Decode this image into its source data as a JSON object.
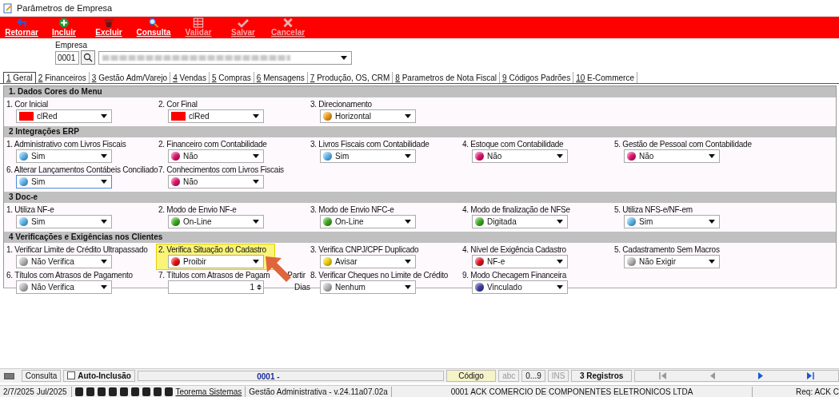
{
  "window": {
    "title": "Parâmetros de Empresa"
  },
  "toolbar": [
    {
      "label": "Retornar",
      "disabled": false
    },
    {
      "label": "Incluir",
      "disabled": false
    },
    {
      "label": "Excluir",
      "disabled": false
    },
    {
      "label": "Consulta",
      "disabled": false
    },
    {
      "label": "Validar",
      "disabled": true
    },
    {
      "label": "Salvar",
      "disabled": true
    },
    {
      "label": "Cancelar",
      "disabled": true
    }
  ],
  "empresa": {
    "label": "Empresa",
    "code": "0001"
  },
  "tabs": [
    {
      "number": "1",
      "label": "Geral",
      "selected": true
    },
    {
      "number": "2",
      "label": "Financeiros",
      "selected": false
    },
    {
      "number": "3",
      "label": "Gestão Adm/Varejo",
      "selected": false
    },
    {
      "number": "4",
      "label": "Vendas",
      "selected": false
    },
    {
      "number": "5",
      "label": "Compras",
      "selected": false
    },
    {
      "number": "6",
      "label": "Mensagens",
      "selected": false
    },
    {
      "number": "7",
      "label": "Produção, OS, CRM",
      "selected": false
    },
    {
      "number": "8",
      "label": "Parametros de Nota Fiscal",
      "selected": false
    },
    {
      "number": "9",
      "label": "Códigos Padrões",
      "selected": false
    },
    {
      "number": "10",
      "label": "E-Commerce",
      "selected": false
    }
  ],
  "sections": [
    {
      "title": "1.  Dados Cores do Menu",
      "fields": [
        {
          "label": "1. Cor Inicial",
          "kind": "color",
          "value": "clRed",
          "color": "#ff0000"
        },
        {
          "label": "2. Cor Final",
          "kind": "color",
          "value": "clRed",
          "color": "#ff0000"
        },
        {
          "label": "3. Direcionamento",
          "kind": "select",
          "value": "Horizontal",
          "color": "#f39a12"
        }
      ]
    },
    {
      "title": "2 Integrações ERP",
      "fields": [
        {
          "label": "1. Administrativo com Livros Fiscais",
          "kind": "select",
          "value": "Sim",
          "color": "#5ab4ee"
        },
        {
          "label": "2. Financeiro com Contabilidade",
          "kind": "select",
          "value": "Não",
          "color": "#e0106a"
        },
        {
          "label": "3. Livros Fiscais com Contabilidade",
          "kind": "select",
          "value": "Sim",
          "color": "#5ab4ee"
        },
        {
          "label": "4. Estoque com Contabilidade",
          "kind": "select",
          "value": "Não",
          "color": "#e0106a"
        },
        {
          "label": "5. Gestão de Pessoal com Contabilidade",
          "kind": "select",
          "value": "Não",
          "color": "#e0106a"
        },
        {
          "label": "6. Alterar Lançamentos Contábeis Conciliado",
          "kind": "select",
          "value": "Sim",
          "color": "#5ab4ee",
          "focused": true
        },
        {
          "label": "7. Conhecimentos com Livros Fiscais",
          "kind": "select",
          "value": "Não",
          "color": "#e0106a"
        }
      ]
    },
    {
      "title": "3  Doc-e",
      "fields": [
        {
          "label": "1. Utiliza NF-e",
          "kind": "select",
          "value": "Sim",
          "color": "#5ab4ee"
        },
        {
          "label": "2. Modo de Envio NF-e",
          "kind": "select",
          "value": "On-Line",
          "color": "#3aaa1e"
        },
        {
          "label": "3. Modo de Envio NFC-e",
          "kind": "select",
          "value": "On-Line",
          "color": "#3aaa1e"
        },
        {
          "label": "4. Modo de finalização de NFSe",
          "kind": "select",
          "value": "Digitada",
          "color": "#3aaa1e"
        },
        {
          "label": "5. Utiliza NFS-e/NF-em",
          "kind": "select",
          "value": "Sim",
          "color": "#5ab4ee"
        }
      ]
    },
    {
      "title": "4 Verificações e Exigências nos Clientes",
      "fields": [
        {
          "label": "1. Verificar Limite de Crédito Ultrapassado",
          "kind": "select",
          "value": "Não Verifica",
          "color": "#b4b4b4"
        },
        {
          "label": "2. Verifica Situação do Cadastro",
          "kind": "select",
          "value": "Proibir",
          "color": "#e81010",
          "highlighted": true
        },
        {
          "label": "3. Verifica CNPJ/CPF Duplicado",
          "kind": "select",
          "value": "Avisar",
          "color": "#f0d000"
        },
        {
          "label": "4. Nível de Exigência Cadastro",
          "kind": "select",
          "value": "NF-e",
          "color": "#e01020"
        },
        {
          "label": "5. Cadastramento Sem Macros",
          "kind": "select",
          "value": "Não Exigir",
          "color": "#b4b4b4"
        },
        {
          "label": "6. Títulos com Atrasos de Pagamento",
          "kind": "select",
          "value": "Não Verifica",
          "color": "#b4b4b4"
        },
        {
          "label": "7. Títulos com Atrasos de Pagam",
          "label_end": "Partir",
          "kind": "spin",
          "value": "1",
          "suffix": "Dias"
        },
        {
          "label": "8. Verificar Cheques no Limite de Crédito",
          "kind": "select",
          "value": "Nenhum",
          "color": "#b4b4b4"
        },
        {
          "label": "9. Modo Checagem Financeira",
          "kind": "select",
          "value": "Vinculado",
          "color": "#3c3c9c"
        }
      ]
    }
  ],
  "status_bar": {
    "mode": "Consulta",
    "auto_inclusao": {
      "label": "Auto-Inclusão",
      "checked": false
    },
    "key": "0001 -",
    "order": "Código",
    "abc": "abc",
    "digits": "0...9",
    "ins": "INS",
    "records": "3 Registros",
    "nav": [
      {
        "disabled": true
      },
      {
        "disabled": true
      },
      {
        "disabled": false
      },
      {
        "disabled": false
      }
    ]
  },
  "footer": {
    "date": "2/7/2025 Jul/2025",
    "link": "Teorema Sistemas",
    "product": "Gestão Administrativa - v.24.11a07.02a",
    "company": "0001 ACK COMERCIO DE COMPONENTES ELETRONICOS LTDA",
    "req": "Req: ACK C"
  }
}
